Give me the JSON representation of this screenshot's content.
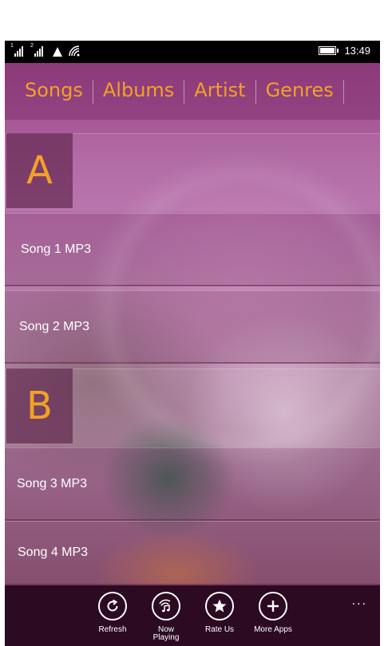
{
  "status_bar": {
    "sim1_label": "1",
    "sim2_label": "2",
    "time": "13:49"
  },
  "tabs": [
    {
      "label": "Songs"
    },
    {
      "label": "Albums"
    },
    {
      "label": "Artist"
    },
    {
      "label": "Genres"
    }
  ],
  "groups": [
    {
      "letter": "A",
      "songs": [
        "Song 1 MP3",
        "Song 2 MP3"
      ]
    },
    {
      "letter": "B",
      "songs": [
        "Song 3 MP3",
        "Song 4 MP3"
      ]
    }
  ],
  "app_bar": {
    "buttons": [
      {
        "label": "Refresh",
        "icon": "refresh-icon"
      },
      {
        "label": "Now\nPlaying",
        "icon": "music-note-icon"
      },
      {
        "label": "Rate Us",
        "icon": "star-icon"
      },
      {
        "label": "More Apps",
        "icon": "plus-icon"
      }
    ],
    "more": "..."
  },
  "colors": {
    "accent": "#f3a028",
    "app_bar_bg": "#2b0a22",
    "status_bar_bg": "#000000",
    "text": "#ffffff"
  }
}
